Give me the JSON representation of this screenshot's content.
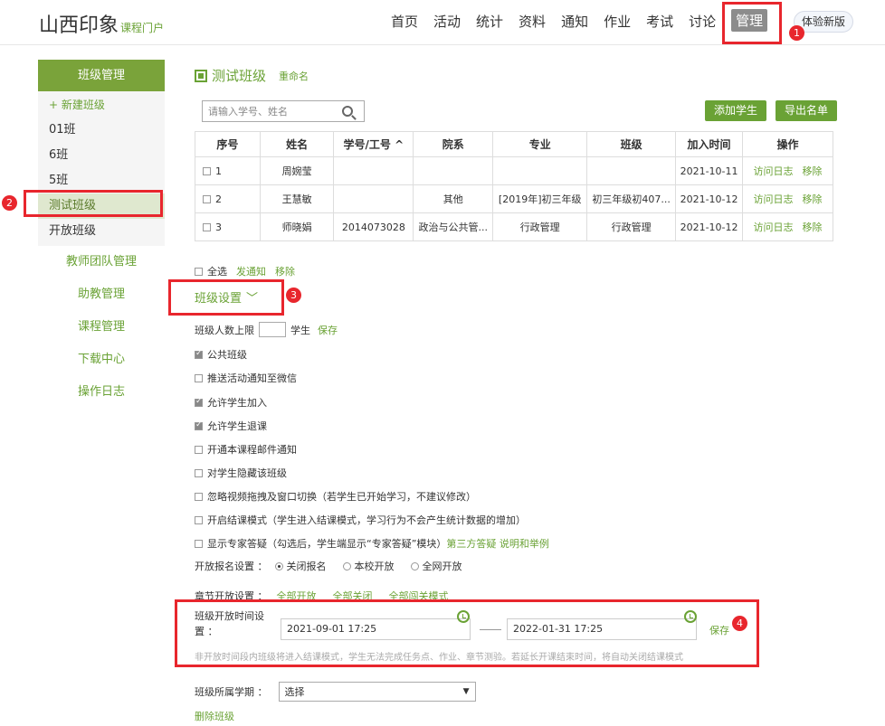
{
  "header": {
    "logo_main": "山西印象",
    "logo_sub": "课程门户",
    "nav": [
      "首页",
      "活动",
      "统计",
      "资料",
      "通知",
      "作业",
      "考试",
      "讨论",
      "管理"
    ],
    "try_new": "体验新版"
  },
  "sidebar": {
    "title": "班级管理",
    "new_class": "+ 新建班级",
    "classes": [
      "01班",
      "6班",
      "5班",
      "测试班级",
      "开放班级"
    ],
    "links": [
      "教师团队管理",
      "助教管理",
      "课程管理",
      "下载中心",
      "操作日志"
    ]
  },
  "main": {
    "class_name": "测试班级",
    "rename": "重命名",
    "search_placeholder": "请输入学号、姓名",
    "add_student": "添加学生",
    "export_list": "导出名单",
    "columns": [
      "序号",
      "姓名",
      "学号/工号 ^",
      "院系",
      "专业",
      "班级",
      "加入时间",
      "操作"
    ],
    "rows": [
      {
        "no": "1",
        "name": "周婉莹",
        "id": "",
        "dept": "",
        "major": "",
        "cls": "",
        "time": "2021-10-11"
      },
      {
        "no": "2",
        "name": "王慧敏",
        "id": "",
        "dept": "其他",
        "major": "[2019年]初三年级",
        "cls": "初三年级初407...",
        "time": "2021-10-12"
      },
      {
        "no": "3",
        "name": "师晓娟",
        "id": "2014073028",
        "dept": "政治与公共管...",
        "major": "行政管理",
        "cls": "行政管理",
        "time": "2021-10-12"
      }
    ],
    "op_log": "访问日志",
    "op_remove": "移除",
    "select_all": "全选",
    "send_notice": "发通知",
    "remove": "移除"
  },
  "settings": {
    "title": "班级设置",
    "chevron": "﹀",
    "limit_label": "班级人数上限",
    "limit_unit": "学生",
    "save": "保存",
    "options": [
      {
        "label": "公共班级",
        "checked": true
      },
      {
        "label": "推送活动通知至微信",
        "checked": false
      },
      {
        "label": "允许学生加入",
        "checked": true
      },
      {
        "label": "允许学生退课",
        "checked": true
      },
      {
        "label": "开通本课程邮件通知",
        "checked": false
      },
      {
        "label": "对学生隐藏该班级",
        "checked": false
      },
      {
        "label": "忽略视频拖拽及窗口切换（若学生已开始学习，不建议修改）",
        "checked": false
      },
      {
        "label": "开启结课模式（学生进入结课模式，学习行为不会产生统计数据的增加）",
        "checked": false
      }
    ],
    "expert_label": "显示专家答疑（勾选后，学生端显示“专家答疑”模块）",
    "expert_link": "第三方答疑 说明和举例",
    "signup_label": "开放报名设置 ：",
    "signup_options": [
      "关闭报名",
      "本校开放",
      "全网开放"
    ],
    "chapter_label": "章节开放设置 ：",
    "chapter_links": [
      "全部开放",
      "全部关闭",
      "全部闯关模式"
    ],
    "time_label_1": "班级开放时间设",
    "time_label_2": "置 ：",
    "start_time": "2021-09-01 17:25",
    "end_time": "2022-01-31 17:25",
    "time_save": "保存",
    "time_hint": "非开放时间段内班级将进入结课模式，学生无法完成任务点、作业、章节测验。若延长开课结束时间，将自动关闭结课模式",
    "term_label": "班级所属学期 ：",
    "term_value": "选择",
    "delete_class": "删除班级"
  },
  "annotations": [
    "1",
    "2",
    "3",
    "4"
  ]
}
